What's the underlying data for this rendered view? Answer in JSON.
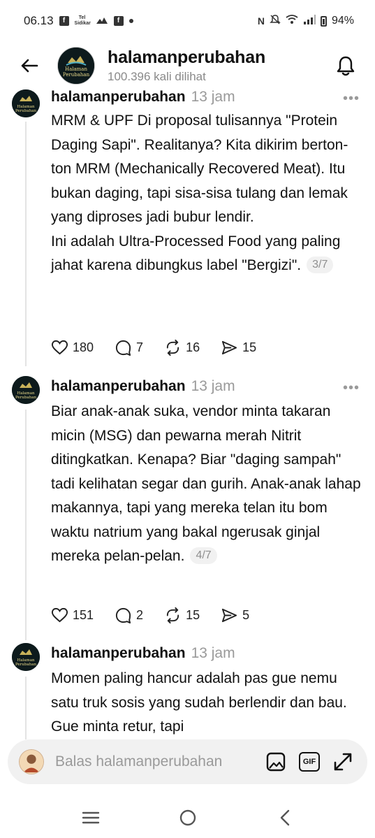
{
  "status_bar": {
    "time": "06.13",
    "battery": "94%",
    "small_label": "Tel Sidikar"
  },
  "header": {
    "name": "halamanperubahan",
    "views": "100.396 kali dilihat",
    "avatar_text": "Halaman Perubahan"
  },
  "posts": [
    {
      "user": "halamanperubahan",
      "time": "13 jam",
      "text": "MRM & UPF Di proposal tulisannya \"Protein Daging Sapi\". Realitanya? Kita dikirim berton-ton MRM (Mechanically Recovered Meat). Itu bukan daging, tapi sisa-sisa tulang dan lemak yang diproses jadi bubur lendir.\nIni adalah Ultra-Processed Food yang paling jahat karena dibungkus label \"Bergizi\".",
      "pager": "3/7",
      "likes": "180",
      "replies": "7",
      "reposts": "16",
      "shares": "15"
    },
    {
      "user": "halamanperubahan",
      "time": "13 jam",
      "text": "Biar anak-anak suka, vendor minta takaran micin (MSG) dan pewarna merah Nitrit ditingkatkan. Kenapa? Biar \"daging sampah\" tadi kelihatan segar dan gurih. Anak-anak lahap makannya, tapi yang mereka telan itu bom waktu natrium yang bakal ngerusak ginjal mereka pelan-pelan.",
      "pager": "4/7",
      "likes": "151",
      "replies": "2",
      "reposts": "15",
      "shares": "5"
    },
    {
      "user": "halamanperubahan",
      "time": "13 jam",
      "text": "Momen paling hancur adalah pas gue nemu satu truk sosis yang sudah berlendir dan bau. Gue minta retur, tapi"
    }
  ],
  "reply_bar": {
    "placeholder": "Balas halamanperubahan",
    "gif_label": "GIF"
  },
  "colors": {
    "text": "#111111",
    "muted": "#9a9a9a",
    "thread_line": "#e4e4e4",
    "reply_bg": "#f1f1f1"
  }
}
